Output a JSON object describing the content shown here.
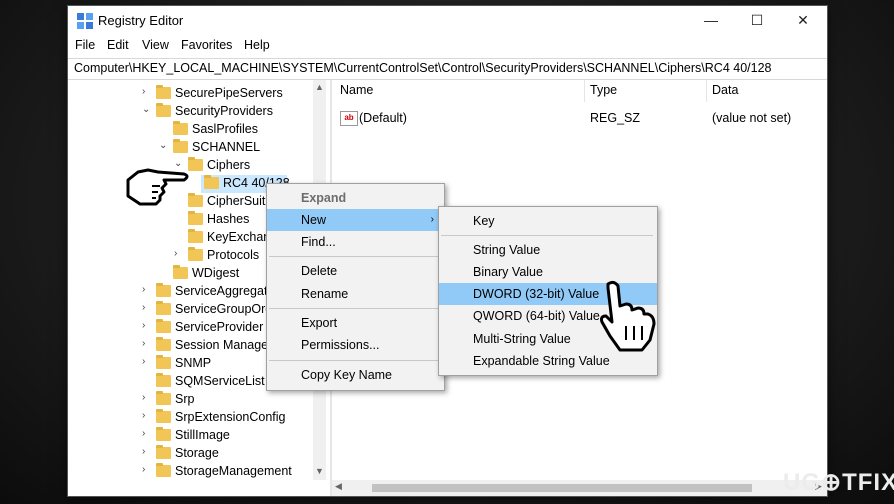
{
  "window": {
    "title": "Registry Editor",
    "minimize": "—",
    "maximize": "☐",
    "close": "✕"
  },
  "menubar": [
    "File",
    "Edit",
    "View",
    "Favorites",
    "Help"
  ],
  "address": "Computer\\HKEY_LOCAL_MACHINE\\SYSTEM\\CurrentControlSet\\Control\\SecurityProviders\\SCHANNEL\\Ciphers\\RC4 40/128",
  "tree": [
    {
      "label": "SecurePipeServers",
      "chev": "›"
    },
    {
      "label": "SecurityProviders",
      "chev": "⌄"
    },
    {
      "label": "SaslProfiles",
      "chev": ""
    },
    {
      "label": "SCHANNEL",
      "chev": "⌄"
    },
    {
      "label": "Ciphers",
      "chev": "⌄"
    },
    {
      "label": "RC4 40/128",
      "chev": ""
    },
    {
      "label": "CipherSuit",
      "chev": ""
    },
    {
      "label": "Hashes",
      "chev": ""
    },
    {
      "label": "KeyExchan",
      "chev": ""
    },
    {
      "label": "Protocols",
      "chev": "›"
    },
    {
      "label": "WDigest",
      "chev": ""
    },
    {
      "label": "ServiceAggregate",
      "chev": "›"
    },
    {
      "label": "ServiceGroupOrd",
      "chev": "›"
    },
    {
      "label": "ServiceProvider",
      "chev": "›"
    },
    {
      "label": "Session Manager",
      "chev": "›"
    },
    {
      "label": "SNMP",
      "chev": "›"
    },
    {
      "label": "SQMServiceList",
      "chev": ""
    },
    {
      "label": "Srp",
      "chev": "›"
    },
    {
      "label": "SrpExtensionConfig",
      "chev": "›"
    },
    {
      "label": "StillImage",
      "chev": "›"
    },
    {
      "label": "Storage",
      "chev": "›"
    },
    {
      "label": "StorageManagement",
      "chev": "›"
    }
  ],
  "list": {
    "columns": [
      "Name",
      "Type",
      "Data"
    ],
    "rows": [
      {
        "name": "(Default)",
        "type": "REG_SZ",
        "data": "(value not set)",
        "icon": "ab"
      }
    ]
  },
  "context_menu": {
    "items": [
      "Expand",
      "New",
      "Find...",
      "Delete",
      "Rename",
      "Export",
      "Permissions...",
      "Copy Key Name"
    ],
    "submenu_arrow": "›"
  },
  "submenu": {
    "items": [
      "Key",
      "String Value",
      "Binary Value",
      "DWORD (32-bit) Value",
      "QWORD (64-bit) Value",
      "Multi-String Value",
      "Expandable String Value"
    ]
  },
  "watermark": "UG⊕TFIX",
  "colors": {
    "highlight": "#91c9f7",
    "folder": "#f1c657",
    "selection": "#cce8ff"
  }
}
